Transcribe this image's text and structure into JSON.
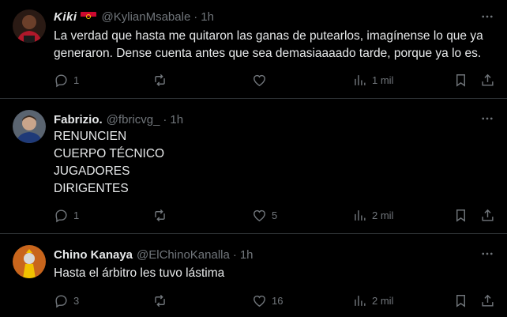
{
  "tweets": [
    {
      "name": "Kiki",
      "handle": "@KylianMsabale",
      "sep": "·",
      "time": "1h",
      "text": "La verdad que hasta me quitaron las ganas de putearlos, imagínense lo que ya\ngeneraron. Dense cuenta antes que sea demasiaaaado tarde, porque ya lo es.",
      "replies": "1",
      "retweets": "",
      "likes": "",
      "views": "1 mil"
    },
    {
      "name": "Fabrizio.",
      "handle": "@fbricvg_",
      "sep": "·",
      "time": "1h",
      "text": "RENUNCIEN\nCUERPO TÉCNICO\nJUGADORES\nDIRIGENTES",
      "replies": "1",
      "retweets": "",
      "likes": "5",
      "views": "2 mil"
    },
    {
      "name": "Chino Kanaya",
      "handle": "@ElChinoKanalla",
      "sep": "·",
      "time": "1h",
      "text": "Hasta el árbitro les tuvo lástima",
      "replies": "3",
      "retweets": "",
      "likes": "16",
      "views": "2 mil"
    }
  ],
  "colors": {
    "background": "#000000",
    "text": "#e7e9ea",
    "muted": "#71767b",
    "border": "#2f3336"
  },
  "icons": [
    "reply-icon",
    "retweet-icon",
    "like-icon",
    "views-icon",
    "bookmark-icon",
    "share-icon",
    "more-icon"
  ]
}
